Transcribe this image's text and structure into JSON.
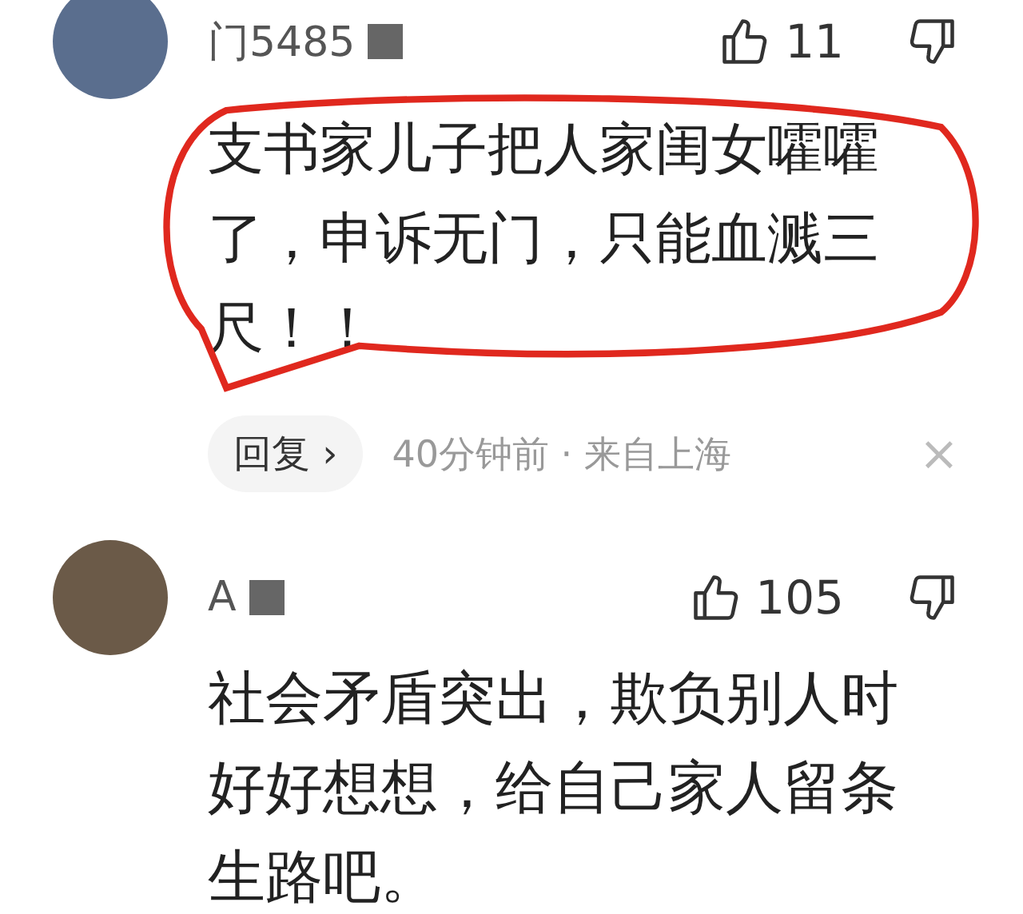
{
  "comments": [
    {
      "username": "门5485",
      "likes": "11",
      "text": "支书家儿子把人家闺女嚯嚯了，申诉无门，只能血溅三尺！！",
      "reply_label": "回复",
      "reply_chevron": "›",
      "meta": "40分钟前 · 来自上海",
      "dismiss": "×",
      "circled": true
    },
    {
      "username": "A",
      "likes": "105",
      "text": "社会矛盾突出，欺负别人时好好想想，给自己家人留条生路吧。",
      "circled": false
    }
  ]
}
